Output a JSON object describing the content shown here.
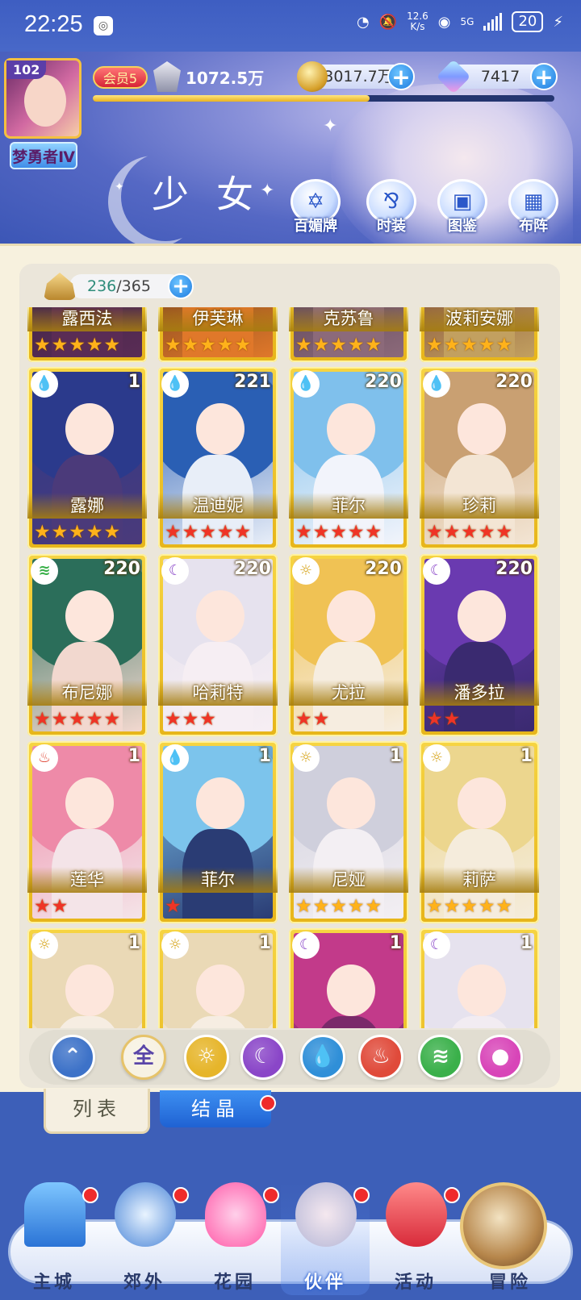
{
  "status_bar": {
    "time": "22:25",
    "net_speed_value": "12.6",
    "net_speed_unit": "K/s",
    "battery": "20",
    "network": "5G"
  },
  "header": {
    "level": "102",
    "rank_title": "梦勇者Ⅳ",
    "vip_label": "会员5",
    "power": "1072.5万",
    "gold": "3017.7万",
    "gems": "7417",
    "xp_fraction": 0.6
  },
  "banner": {
    "title": "少女",
    "quick_buttons": [
      {
        "label": "百媚牌",
        "icon": "card-icon"
      },
      {
        "label": "时装",
        "icon": "outfit-icon"
      },
      {
        "label": "图鉴",
        "icon": "book-icon"
      },
      {
        "label": "布阵",
        "icon": "grid-icon"
      }
    ]
  },
  "collection": {
    "current": "236",
    "separator": "/",
    "max": "365"
  },
  "cards": [
    {
      "name": "露西法",
      "level": "",
      "element": "",
      "stars": 5,
      "star_color": "gold",
      "palette": [
        "#2d2240",
        "#5a2c55"
      ]
    },
    {
      "name": "伊芙琳",
      "level": "",
      "element": "",
      "stars": 5,
      "star_color": "gold",
      "palette": [
        "#3a2418",
        "#e0782a"
      ]
    },
    {
      "name": "克苏鲁",
      "level": "",
      "element": "",
      "stars": 5,
      "star_color": "gold",
      "palette": [
        "#3a2a40",
        "#8c6a7a"
      ]
    },
    {
      "name": "波莉安娜",
      "level": "",
      "element": "",
      "stars": 5,
      "star_color": "gold",
      "palette": [
        "#5a1a20",
        "#c2a060"
      ]
    },
    {
      "name": "露娜",
      "level": "1",
      "element": "water",
      "stars": 5,
      "star_color": "gold",
      "palette": [
        "#2b3a8c",
        "#4b3a7a"
      ]
    },
    {
      "name": "温迪妮",
      "level": "221",
      "element": "water",
      "stars": 5,
      "star_color": "red",
      "palette": [
        "#2a5fb4",
        "#e8eef8"
      ]
    },
    {
      "name": "菲尔",
      "level": "220",
      "element": "water",
      "stars": 5,
      "star_color": "red",
      "palette": [
        "#7fc0ec",
        "#f2f4fb"
      ]
    },
    {
      "name": "珍莉",
      "level": "220",
      "element": "water",
      "stars": 5,
      "star_color": "red",
      "palette": [
        "#c9a072",
        "#f3e5d4"
      ]
    },
    {
      "name": "布尼娜",
      "level": "220",
      "element": "wind",
      "stars": 5,
      "star_color": "red",
      "palette": [
        "#2b6e5a",
        "#f2d8cf"
      ]
    },
    {
      "name": "哈莉特",
      "level": "220",
      "element": "moon",
      "stars": 3,
      "star_color": "red",
      "palette": [
        "#e6e2ee",
        "#f6eef3"
      ]
    },
    {
      "name": "尤拉",
      "level": "220",
      "element": "sun",
      "stars": 2,
      "star_color": "red",
      "palette": [
        "#f0c254",
        "#f6ede0"
      ]
    },
    {
      "name": "潘多拉",
      "level": "220",
      "element": "moon",
      "stars": 2,
      "star_color": "red",
      "palette": [
        "#6a3ab0",
        "#3a2a70"
      ]
    },
    {
      "name": "莲华",
      "level": "1",
      "element": "fire",
      "stars": 2,
      "star_color": "red",
      "palette": [
        "#ee8aa8",
        "#f4e4e8"
      ]
    },
    {
      "name": "菲尔",
      "level": "1",
      "element": "water",
      "stars": 1,
      "star_color": "red",
      "palette": [
        "#7cc4ec",
        "#2a3c74"
      ]
    },
    {
      "name": "尼娅",
      "level": "1",
      "element": "sun",
      "stars": 5,
      "star_color": "gold",
      "palette": [
        "#cfcfdc",
        "#f3eff3"
      ]
    },
    {
      "name": "莉萨",
      "level": "1",
      "element": "sun",
      "stars": 5,
      "star_color": "gold",
      "palette": [
        "#ecd68e",
        "#f5ecdc"
      ]
    },
    {
      "name": "",
      "level": "1",
      "element": "sun",
      "stars": 0,
      "star_color": "gold",
      "palette": [
        "#ead9b6",
        "#f6ede2"
      ]
    },
    {
      "name": "",
      "level": "1",
      "element": "sun",
      "stars": 0,
      "star_color": "gold",
      "palette": [
        "#ead9b6",
        "#f6ede2"
      ]
    },
    {
      "name": "",
      "level": "1",
      "element": "moon",
      "stars": 0,
      "star_color": "gold",
      "palette": [
        "#c23a8a",
        "#7a2a6a"
      ]
    },
    {
      "name": "",
      "level": "1",
      "element": "moon",
      "stars": 0,
      "star_color": "gold",
      "palette": [
        "#e6e2ee",
        "#f2ecf2"
      ]
    }
  ],
  "filters": [
    {
      "key": "wind-up",
      "label": "",
      "color": "#3d72c8",
      "icon": "up-arrow-icon"
    },
    {
      "key": "all",
      "label": "全",
      "color": "#f7f2e2",
      "icon": "all-icon"
    },
    {
      "key": "sun",
      "label": "☼",
      "color": "#e6b52a",
      "icon": "sun-icon"
    },
    {
      "key": "moon",
      "label": "☾",
      "color": "#8a46c8",
      "icon": "moon-icon"
    },
    {
      "key": "water",
      "label": "💧",
      "color": "#2f8fd8",
      "icon": "water-icon"
    },
    {
      "key": "fire",
      "label": "♨",
      "color": "#e04a3a",
      "icon": "fire-icon"
    },
    {
      "key": "wind",
      "label": "≋",
      "color": "#3ab04a",
      "icon": "wind-icon"
    },
    {
      "key": "charm",
      "label": "●",
      "color": "#d845b8",
      "icon": "charm-icon"
    }
  ],
  "tabs": {
    "list": "列表",
    "crystal": "结晶"
  },
  "nav": [
    {
      "label": "主城",
      "icon": "castle-icon",
      "badge": true,
      "active": false
    },
    {
      "label": "郊外",
      "icon": "star-gate-icon",
      "badge": true,
      "active": false
    },
    {
      "label": "花园",
      "icon": "heart-icon",
      "badge": true,
      "active": false
    },
    {
      "label": "伙伴",
      "icon": "partner-icon",
      "badge": true,
      "active": true
    },
    {
      "label": "活动",
      "icon": "gift-icon",
      "badge": true,
      "active": false
    },
    {
      "label": "冒险",
      "icon": "compass-icon",
      "badge": false,
      "active": false
    }
  ]
}
